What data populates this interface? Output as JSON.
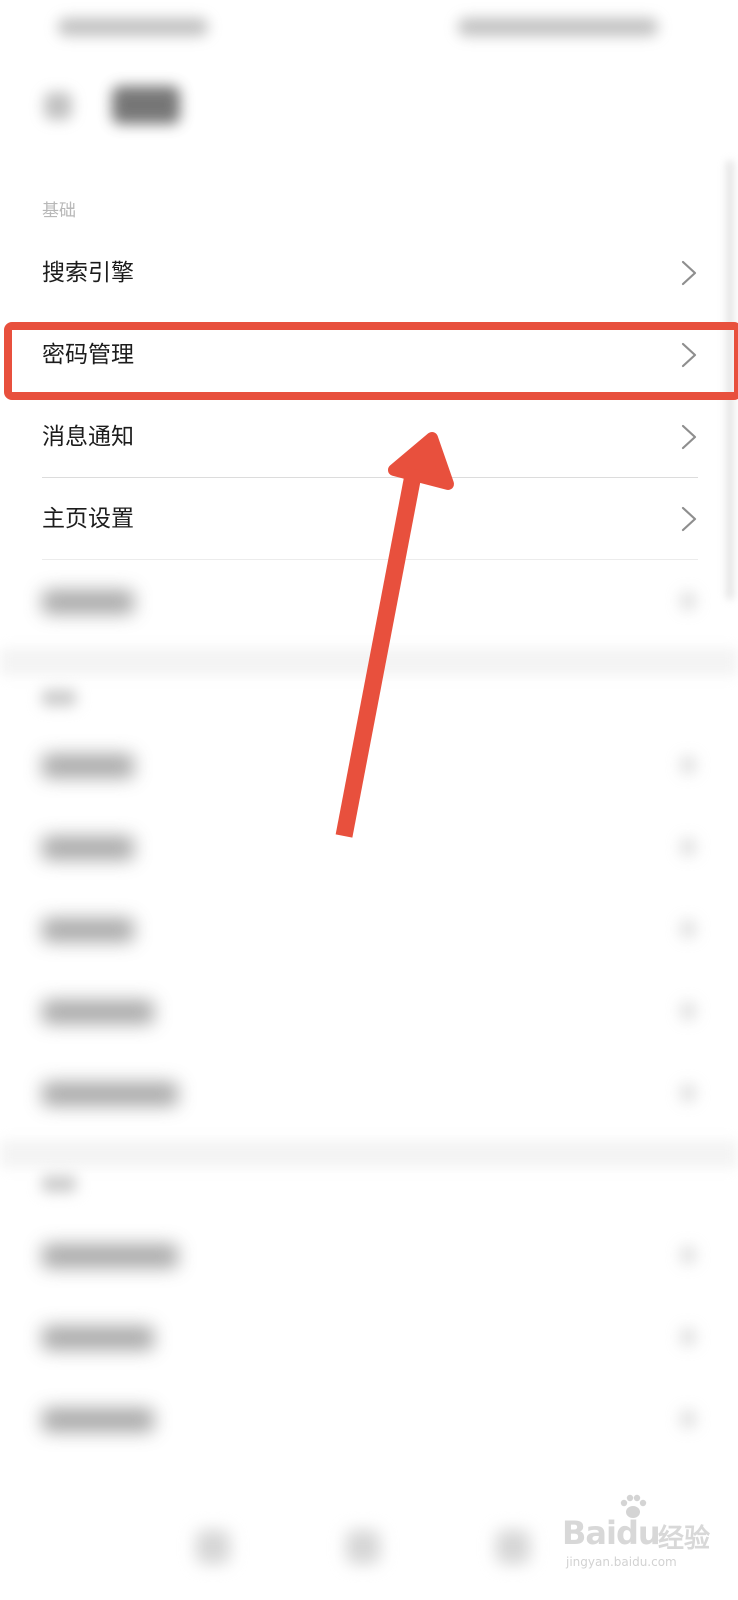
{
  "section_basic": "基础",
  "rows": [
    {
      "label": "搜索引擎"
    },
    {
      "label": "密码管理"
    },
    {
      "label": "消息通知"
    },
    {
      "label": "主页设置"
    }
  ],
  "colors": {
    "highlight": "#e8503d",
    "arrow": "#e8503d",
    "text": "#1c1c1c",
    "section": "#b8b8b8",
    "chevron": "#8e8e8e"
  },
  "icons": {
    "chevron": "chevron-right-icon",
    "back": "back-arrow-icon"
  },
  "watermark": {
    "brand": "Baidu",
    "cn": "经验",
    "url": "jingyan.baidu.com"
  }
}
